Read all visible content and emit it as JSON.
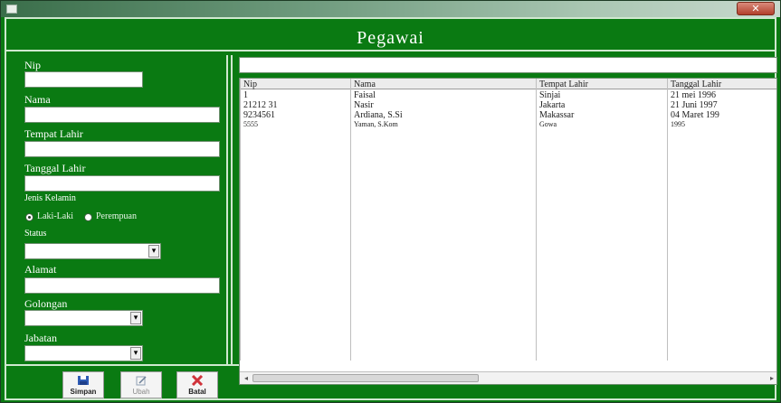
{
  "window": {
    "title": "",
    "close_glyph": "✕"
  },
  "header": {
    "title": "Pegawai"
  },
  "form": {
    "nip_label": "Nip",
    "nama_label": "Nama",
    "tempat_lahir_label": "Tempat Lahir",
    "tanggal_lahir_label": "Tanggal Lahir",
    "jenis_kelamin_label": "Jenis Kelamin",
    "radio_laki": "Laki-Laki",
    "radio_perempuan": "Perempuan",
    "status_label": "Status",
    "alamat_label": "Alamat",
    "golongan_label": "Golongan",
    "jabatan_label": "Jabatan",
    "combo_glyph": "▾"
  },
  "buttons": {
    "simpan": "Simpan",
    "simpan_icon": "floppy-disk-icon",
    "simpan_color": "#2e5bb5",
    "ubah": "Ubah",
    "ubah_icon": "edit-icon",
    "batal": "Batal",
    "batal_icon": "cancel-x-icon",
    "batal_color": "#d0323a"
  },
  "table": {
    "columns": [
      "Nip",
      "Nama",
      "Tempat Lahir",
      "Tanggal Lahir"
    ],
    "rows": [
      [
        "1",
        "Faisal",
        "Sinjai",
        "21 mei 1996"
      ],
      [
        "21212 31",
        "Nasir",
        "Jakarta",
        "21 Juni 1997"
      ],
      [
        "9234561",
        "Ardiana, S.Si",
        "Makassar",
        "04 Maret 199"
      ],
      [
        "5555",
        "Yaman, S.Kom",
        "Gowa",
        "1995"
      ]
    ]
  },
  "scrollbar": {
    "left_arrow": "◂",
    "right_arrow": "▸"
  }
}
